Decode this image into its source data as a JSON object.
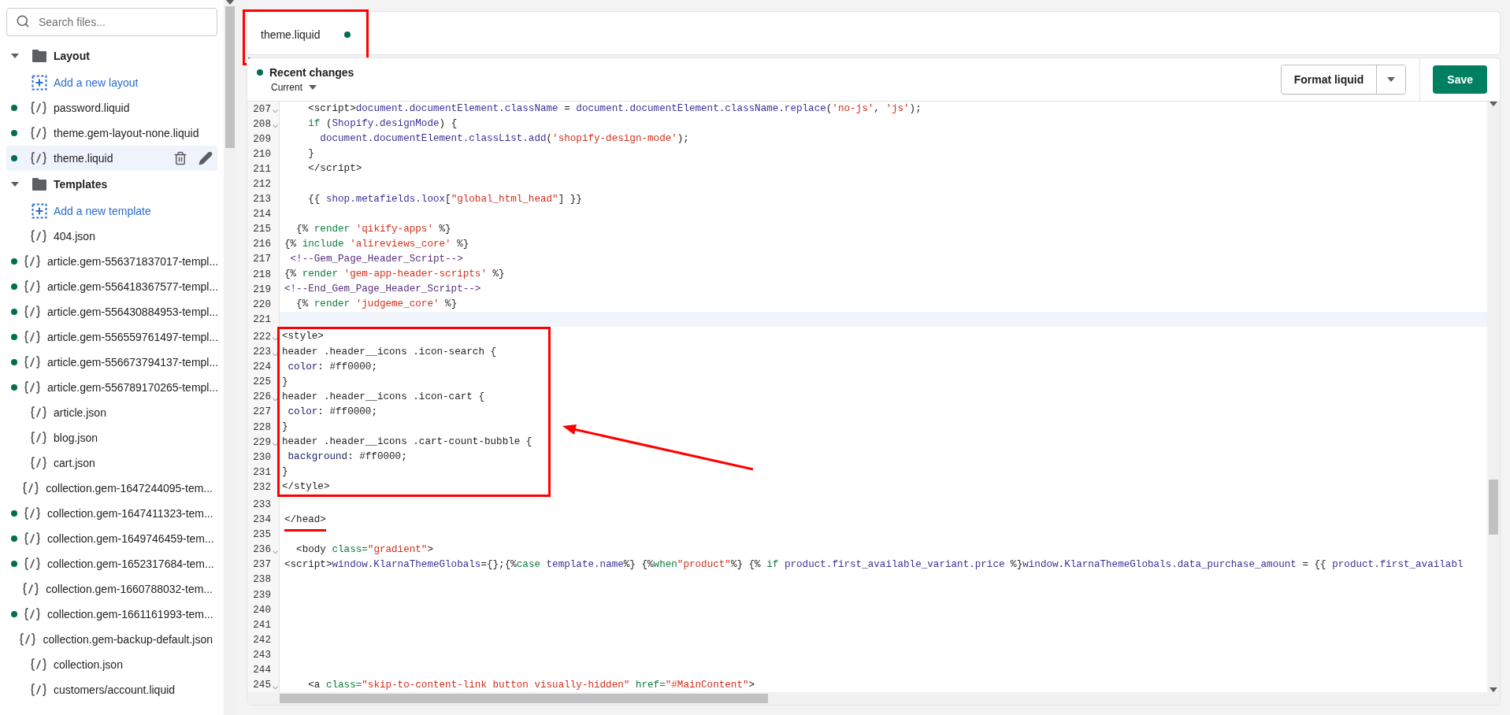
{
  "sidebar": {
    "search": {
      "placeholder": "Search files..."
    },
    "items": [
      {
        "kind": "folder",
        "label": "Layout",
        "expanded": true,
        "children": [
          {
            "kind": "add",
            "label": "Add a new layout"
          },
          {
            "kind": "file",
            "label": "password.liquid",
            "modified": true,
            "selected": false
          },
          {
            "kind": "file",
            "label": "theme.gem-layout-none.liquid",
            "modified": true,
            "selected": false
          },
          {
            "kind": "file",
            "label": "theme.liquid",
            "modified": true,
            "selected": true
          }
        ]
      },
      {
        "kind": "folder",
        "label": "Templates",
        "expanded": true,
        "children": [
          {
            "kind": "add",
            "label": "Add a new template"
          },
          {
            "kind": "file",
            "label": "404.json",
            "modified": false,
            "selected": false
          },
          {
            "kind": "file",
            "label": "article.gem-556371837017-templ...",
            "modified": true,
            "selected": false
          },
          {
            "kind": "file",
            "label": "article.gem-556418367577-templ...",
            "modified": true,
            "selected": false
          },
          {
            "kind": "file",
            "label": "article.gem-556430884953-templ...",
            "modified": true,
            "selected": false
          },
          {
            "kind": "file",
            "label": "article.gem-556559761497-templ...",
            "modified": true,
            "selected": false
          },
          {
            "kind": "file",
            "label": "article.gem-556673794137-templ...",
            "modified": true,
            "selected": false
          },
          {
            "kind": "file",
            "label": "article.gem-556789170265-templ...",
            "modified": true,
            "selected": false
          },
          {
            "kind": "file",
            "label": "article.json",
            "modified": false,
            "selected": false
          },
          {
            "kind": "file",
            "label": "blog.json",
            "modified": false,
            "selected": false
          },
          {
            "kind": "file",
            "label": "cart.json",
            "modified": false,
            "selected": false
          },
          {
            "kind": "file",
            "label": "collection.gem-1647244095-tem...",
            "modified": false,
            "selected": false
          },
          {
            "kind": "file",
            "label": "collection.gem-1647411323-tem...",
            "modified": true,
            "selected": false
          },
          {
            "kind": "file",
            "label": "collection.gem-1649746459-tem...",
            "modified": true,
            "selected": false
          },
          {
            "kind": "file",
            "label": "collection.gem-1652317684-tem...",
            "modified": true,
            "selected": false
          },
          {
            "kind": "file",
            "label": "collection.gem-1660788032-tem...",
            "modified": false,
            "selected": false
          },
          {
            "kind": "file",
            "label": "collection.gem-1661161993-tem...",
            "modified": true,
            "selected": false
          },
          {
            "kind": "file",
            "label": "collection.gem-backup-default.json",
            "modified": false,
            "selected": false
          },
          {
            "kind": "file",
            "label": "collection.json",
            "modified": false,
            "selected": false
          },
          {
            "kind": "file",
            "label": "customers/account.liquid",
            "modified": false,
            "selected": false
          }
        ]
      }
    ]
  },
  "tabs": [
    {
      "label": "theme.liquid",
      "modified": true,
      "selected": true,
      "framed": true
    }
  ],
  "editor": {
    "status": "Recent changes",
    "version": "Current",
    "format_button": "Format liquid",
    "save_button": "Save",
    "lines": [
      {
        "kind": "line",
        "number": "207",
        "foldable": true,
        "active": false,
        "tokens": [
          {
            "kind": "plain",
            "text": "    <script>"
          },
          {
            "kind": "name",
            "text": "document.documentElement.className"
          },
          {
            "kind": "plain",
            "text": " = "
          },
          {
            "kind": "name",
            "text": "document.documentElement.className.replace"
          },
          {
            "kind": "plain",
            "text": "("
          },
          {
            "kind": "string",
            "text": "'no-js'"
          },
          {
            "kind": "plain",
            "text": ", "
          },
          {
            "kind": "string",
            "text": "'js'"
          },
          {
            "kind": "plain",
            "text": ");"
          }
        ]
      },
      {
        "kind": "line",
        "number": "208",
        "foldable": true,
        "active": false,
        "tokens": [
          {
            "kind": "keyword",
            "text": "    if"
          },
          {
            "kind": "plain",
            "text": " ("
          },
          {
            "kind": "name",
            "text": "Shopify.designMode"
          },
          {
            "kind": "plain",
            "text": ") {"
          }
        ]
      },
      {
        "kind": "line",
        "number": "209",
        "foldable": false,
        "active": false,
        "tokens": [
          {
            "kind": "name",
            "text": "      document.documentElement.classList.add"
          },
          {
            "kind": "plain",
            "text": "("
          },
          {
            "kind": "string",
            "text": "'shopify-design-mode'"
          },
          {
            "kind": "plain",
            "text": ");"
          }
        ]
      },
      {
        "kind": "line",
        "number": "210",
        "foldable": false,
        "active": false,
        "tokens": [
          {
            "kind": "plain",
            "text": "    }"
          }
        ]
      },
      {
        "kind": "line",
        "number": "211",
        "foldable": false,
        "active": false,
        "tokens": [
          {
            "kind": "plain",
            "text": "    </script>"
          }
        ]
      },
      {
        "kind": "line",
        "number": "212",
        "foldable": false,
        "active": false
      },
      {
        "kind": "line",
        "number": "213",
        "foldable": false,
        "active": false,
        "tokens": [
          {
            "kind": "plain",
            "text": "    {{ "
          },
          {
            "kind": "name",
            "text": "shop.metafields.loox"
          },
          {
            "kind": "plain",
            "text": "["
          },
          {
            "kind": "string",
            "text": "\"global_html_head\""
          },
          {
            "kind": "plain",
            "text": "] }}"
          }
        ]
      },
      {
        "kind": "line",
        "number": "214",
        "foldable": false,
        "active": false
      },
      {
        "kind": "line",
        "number": "215",
        "foldable": false,
        "active": false,
        "tokens": [
          {
            "kind": "plain",
            "text": "  {% "
          },
          {
            "kind": "keyword",
            "text": "render"
          },
          {
            "kind": "string",
            "text": " 'qikify-apps'"
          },
          {
            "kind": "plain",
            "text": " %}"
          }
        ]
      },
      {
        "kind": "line",
        "number": "216",
        "foldable": false,
        "active": false,
        "tokens": [
          {
            "kind": "plain",
            "text": "{% "
          },
          {
            "kind": "keyword",
            "text": "include"
          },
          {
            "kind": "string",
            "text": " 'alireviews_core'"
          },
          {
            "kind": "plain",
            "text": " %}"
          }
        ]
      },
      {
        "kind": "line",
        "number": "217",
        "foldable": false,
        "active": false,
        "tokens": [
          {
            "kind": "comment",
            "text": " <!--Gem_Page_Header_Script-->"
          }
        ]
      },
      {
        "kind": "line",
        "number": "218",
        "foldable": false,
        "active": false,
        "tokens": [
          {
            "kind": "plain",
            "text": "{% "
          },
          {
            "kind": "keyword",
            "text": "render"
          },
          {
            "kind": "string",
            "text": " 'gem-app-header-scripts'"
          },
          {
            "kind": "plain",
            "text": " %}"
          }
        ]
      },
      {
        "kind": "line",
        "number": "219",
        "foldable": false,
        "active": false,
        "tokens": [
          {
            "kind": "comment",
            "text": "<!--End_Gem_Page_Header_Script-->"
          }
        ]
      },
      {
        "kind": "line",
        "number": "220",
        "foldable": false,
        "active": false,
        "tokens": [
          {
            "kind": "plain",
            "text": "  {% "
          },
          {
            "kind": "keyword",
            "text": "render"
          },
          {
            "kind": "string",
            "text": " 'judgeme_core'"
          },
          {
            "kind": "plain",
            "text": " %}"
          }
        ]
      },
      {
        "kind": "line",
        "number": "221",
        "foldable": false,
        "active": true
      },
      {
        "kind": "frame",
        "arrow": true,
        "lines": [
          {
            "number": "222",
            "foldable": true,
            "tokens": [
              {
                "kind": "plain",
                "text": "<style>"
              }
            ]
          },
          {
            "number": "223",
            "foldable": true,
            "tokens": [
              {
                "kind": "plain",
                "text": "header .header__icons .icon-search {"
              }
            ]
          },
          {
            "number": "224",
            "foldable": false,
            "tokens": [
              {
                "kind": "prop",
                "text": " color"
              },
              {
                "kind": "plain",
                "text": ": #ff0000;"
              }
            ]
          },
          {
            "number": "225",
            "foldable": false,
            "tokens": [
              {
                "kind": "plain",
                "text": "}"
              }
            ]
          },
          {
            "number": "226",
            "foldable": true,
            "tokens": [
              {
                "kind": "plain",
                "text": "header .header__icons .icon-cart {"
              }
            ]
          },
          {
            "number": "227",
            "foldable": false,
            "tokens": [
              {
                "kind": "prop",
                "text": " color"
              },
              {
                "kind": "plain",
                "text": ": #ff0000;"
              }
            ]
          },
          {
            "number": "228",
            "foldable": false,
            "tokens": [
              {
                "kind": "plain",
                "text": "}"
              }
            ]
          },
          {
            "number": "229",
            "foldable": true,
            "tokens": [
              {
                "kind": "plain",
                "text": "header .header__icons .cart-count-bubble {"
              }
            ]
          },
          {
            "number": "230",
            "foldable": false,
            "tokens": [
              {
                "kind": "prop",
                "text": " background"
              },
              {
                "kind": "plain",
                "text": ": #ff0000;"
              }
            ]
          },
          {
            "number": "231",
            "foldable": false,
            "tokens": [
              {
                "kind": "plain",
                "text": "}"
              }
            ]
          },
          {
            "number": "232",
            "foldable": false,
            "tokens": [
              {
                "kind": "plain",
                "text": "</style>"
              }
            ]
          }
        ]
      },
      {
        "kind": "line",
        "number": "233",
        "foldable": false,
        "active": false
      },
      {
        "kind": "line",
        "number": "234",
        "foldable": false,
        "active": false,
        "underlined": true,
        "tokens": [
          {
            "kind": "plain",
            "text": "</head>"
          }
        ]
      },
      {
        "kind": "line",
        "number": "235",
        "foldable": false,
        "active": false
      },
      {
        "kind": "line",
        "number": "236",
        "foldable": true,
        "active": false,
        "tokens": [
          {
            "kind": "plain",
            "text": "  <body "
          },
          {
            "kind": "attr",
            "text": "class="
          },
          {
            "kind": "string",
            "text": "\"gradient\""
          },
          {
            "kind": "plain",
            "text": ">"
          }
        ]
      },
      {
        "kind": "line",
        "number": "237",
        "foldable": false,
        "active": false,
        "tokens": [
          {
            "kind": "plain",
            "text": "<script>"
          },
          {
            "kind": "name",
            "text": "window.KlarnaThemeGlobals"
          },
          {
            "kind": "plain",
            "text": "={};{%"
          },
          {
            "kind": "keyword",
            "text": "case"
          },
          {
            "kind": "name",
            "text": " template.name"
          },
          {
            "kind": "plain",
            "text": "%} {%"
          },
          {
            "kind": "keyword",
            "text": "when"
          },
          {
            "kind": "string",
            "text": "\"product\""
          },
          {
            "kind": "plain",
            "text": "%} {% "
          },
          {
            "kind": "keyword",
            "text": "if"
          },
          {
            "kind": "name",
            "text": " product.first_available_variant.price"
          },
          {
            "kind": "plain",
            "text": " %}"
          },
          {
            "kind": "name",
            "text": "window.KlarnaThemeGlobals.data_purchase_amount"
          },
          {
            "kind": "plain",
            "text": " = {{ "
          },
          {
            "kind": "name",
            "text": "product.first_availabl"
          }
        ]
      },
      {
        "kind": "line",
        "number": "238",
        "foldable": false,
        "active": false
      },
      {
        "kind": "line",
        "number": "239",
        "foldable": false,
        "active": false
      },
      {
        "kind": "line",
        "number": "240",
        "foldable": false,
        "active": false
      },
      {
        "kind": "line",
        "number": "241",
        "foldable": false,
        "active": false
      },
      {
        "kind": "line",
        "number": "242",
        "foldable": false,
        "active": false
      },
      {
        "kind": "line",
        "number": "243",
        "foldable": false,
        "active": false
      },
      {
        "kind": "line",
        "number": "244",
        "foldable": false,
        "active": false
      },
      {
        "kind": "line",
        "number": "245",
        "foldable": true,
        "active": false,
        "tokens": [
          {
            "kind": "plain",
            "text": "    <a "
          },
          {
            "kind": "attr",
            "text": "class="
          },
          {
            "kind": "string",
            "text": "\"skip-to-content-link button visually-hidden\""
          },
          {
            "kind": "attr",
            "text": " href="
          },
          {
            "kind": "string",
            "text": "\"#MainContent\""
          },
          {
            "kind": "plain",
            "text": ">"
          }
        ]
      }
    ]
  }
}
